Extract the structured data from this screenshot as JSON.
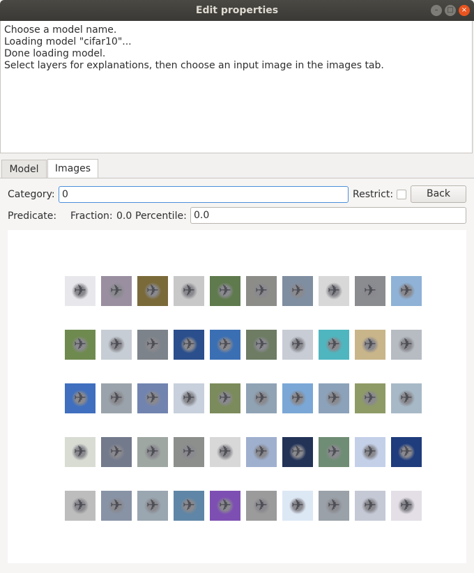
{
  "window": {
    "title": "Edit properties",
    "minimize_glyph": "–",
    "maximize_glyph": "□",
    "close_glyph": "×"
  },
  "log": {
    "lines": [
      "Choose a model name.",
      "Loading model \"cifar10\"...",
      "Done loading model.",
      "Select layers for explanations, then choose an input image in the images tab."
    ]
  },
  "tabs": [
    {
      "label": "Model",
      "active": false
    },
    {
      "label": "Images",
      "active": true
    }
  ],
  "controls": {
    "category_label": "Category:",
    "category_value": "0",
    "restrict_label": "Restrict:",
    "restrict_checked": false,
    "back_label": "Back",
    "predicate_label": "Predicate:",
    "fraction_label": "Fraction:",
    "fraction_value": "0.0",
    "percentile_label": "Percentile:",
    "percentile_value": "0.0"
  },
  "images": {
    "category": "airplane",
    "rows": 5,
    "cols": 10,
    "colors": [
      [
        "#e8e8ec",
        "#9a8fa0",
        "#7a6a3a",
        "#c8c8c8",
        "#5f7a4d",
        "#8c8c88",
        "#7f8ea0",
        "#d8d8d8",
        "#8a8c90",
        "#8fb2d6"
      ],
      [
        "#6f8a4f",
        "#c6cdd4",
        "#7d838a",
        "#2a4f8c",
        "#3b6fb3",
        "#6d7c63",
        "#c7ccd5",
        "#4fb6c0",
        "#c9b58a",
        "#b7bcc3"
      ],
      [
        "#3f6fbe",
        "#9aa3ab",
        "#7184b0",
        "#c7d0dc",
        "#7b8b5b",
        "#8fa3b5",
        "#7aa7d6",
        "#8ca2ba",
        "#8e9b66",
        "#a7b9c7"
      ],
      [
        "#d8dcd3",
        "#737a8c",
        "#9fa7a2",
        "#8c8f8c",
        "#d8d8d8",
        "#9fb0cf",
        "#233357",
        "#6f8d74",
        "#c4d0e8",
        "#1f3c7c"
      ],
      [
        "#bdbdbd",
        "#8893a6",
        "#9aa6b0",
        "#5f86a6",
        "#7e4fb3",
        "#9b9b9b",
        "#dde8f5",
        "#9aa1a8",
        "#c5c9d6",
        "#e4dfe6"
      ]
    ]
  }
}
